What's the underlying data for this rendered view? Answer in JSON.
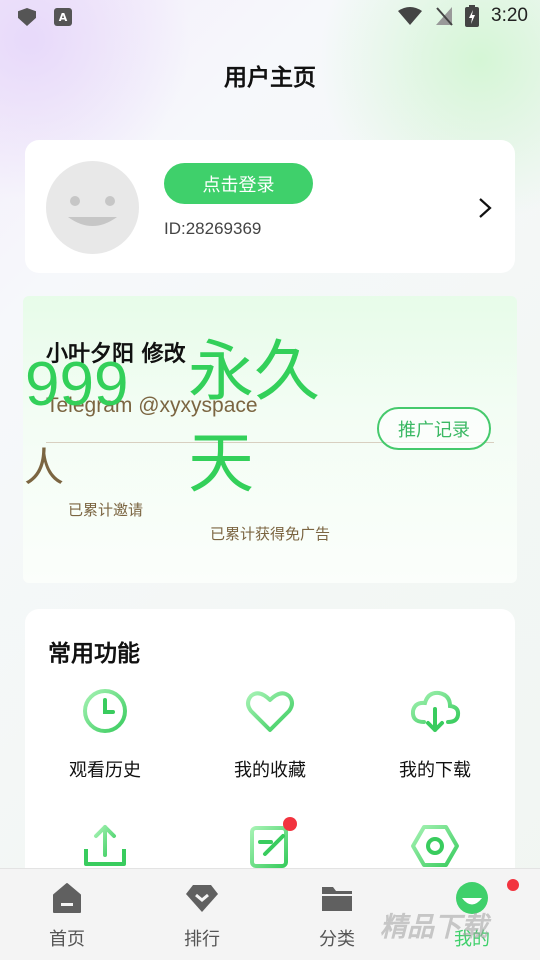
{
  "status_bar": {
    "time": "3:20",
    "app_letter": "A"
  },
  "page_title": "用户主页",
  "profile": {
    "login_label": "点击登录",
    "user_id": "ID:28269369"
  },
  "promo": {
    "title": "小叶夕阳 修改",
    "subtitle": "Telegram @xyxyspace",
    "record_button": "推广记录",
    "invite_count": "999",
    "invite_unit": "人",
    "free_ads_value": "永久天",
    "invite_label": "已累计邀请",
    "free_ads_label": "已累计获得免广告"
  },
  "functions": {
    "title": "常用功能",
    "items": [
      {
        "label": "观看历史",
        "icon": "clock-icon"
      },
      {
        "label": "我的收藏",
        "icon": "heart-icon"
      },
      {
        "label": "我的下载",
        "icon": "cloud-download-icon"
      },
      {
        "label": "",
        "icon": "upload-icon"
      },
      {
        "label": "",
        "icon": "edit-icon"
      },
      {
        "label": "",
        "icon": "settings-icon"
      }
    ]
  },
  "nav": {
    "items": [
      {
        "label": "首页",
        "icon": "home-icon"
      },
      {
        "label": "排行",
        "icon": "diamond-icon"
      },
      {
        "label": "分类",
        "icon": "folder-icon"
      },
      {
        "label": "我的",
        "icon": "profile-icon"
      }
    ],
    "active": "我的"
  },
  "watermark": "精品下载",
  "colors": {
    "accent": "#3fd06b",
    "brown": "#7b6541",
    "badge": "#f2333f"
  }
}
